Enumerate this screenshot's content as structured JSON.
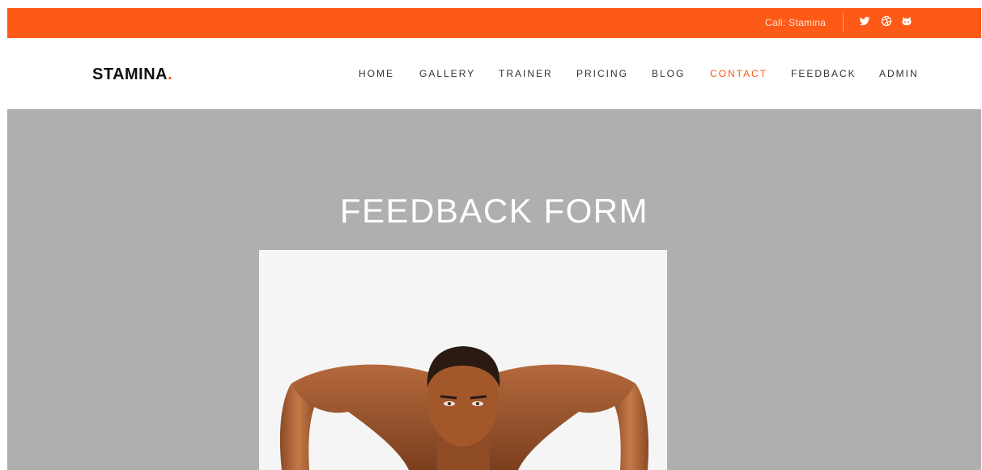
{
  "topbar": {
    "call_text": "Call: Stamina",
    "accent_color": "#fd5917",
    "social_icons": [
      "twitter-icon",
      "dribbble-icon",
      "github-icon"
    ]
  },
  "header": {
    "logo_text": "STAMINA",
    "logo_dot": ".",
    "nav": [
      {
        "label": "HOME",
        "active": false
      },
      {
        "label": "GALLERY",
        "active": false
      },
      {
        "label": "TRAINER",
        "active": false
      },
      {
        "label": "PRICING",
        "active": false
      },
      {
        "label": "BLOG",
        "active": false
      },
      {
        "label": "CONTACT",
        "active": true
      },
      {
        "label": "FEEDBACK",
        "active": false
      },
      {
        "label": "ADMIN",
        "active": false
      }
    ]
  },
  "hero": {
    "title": "FEEDBACK FORM",
    "background_color": "#afafaf",
    "image": "man-doing-pushup-photo"
  }
}
